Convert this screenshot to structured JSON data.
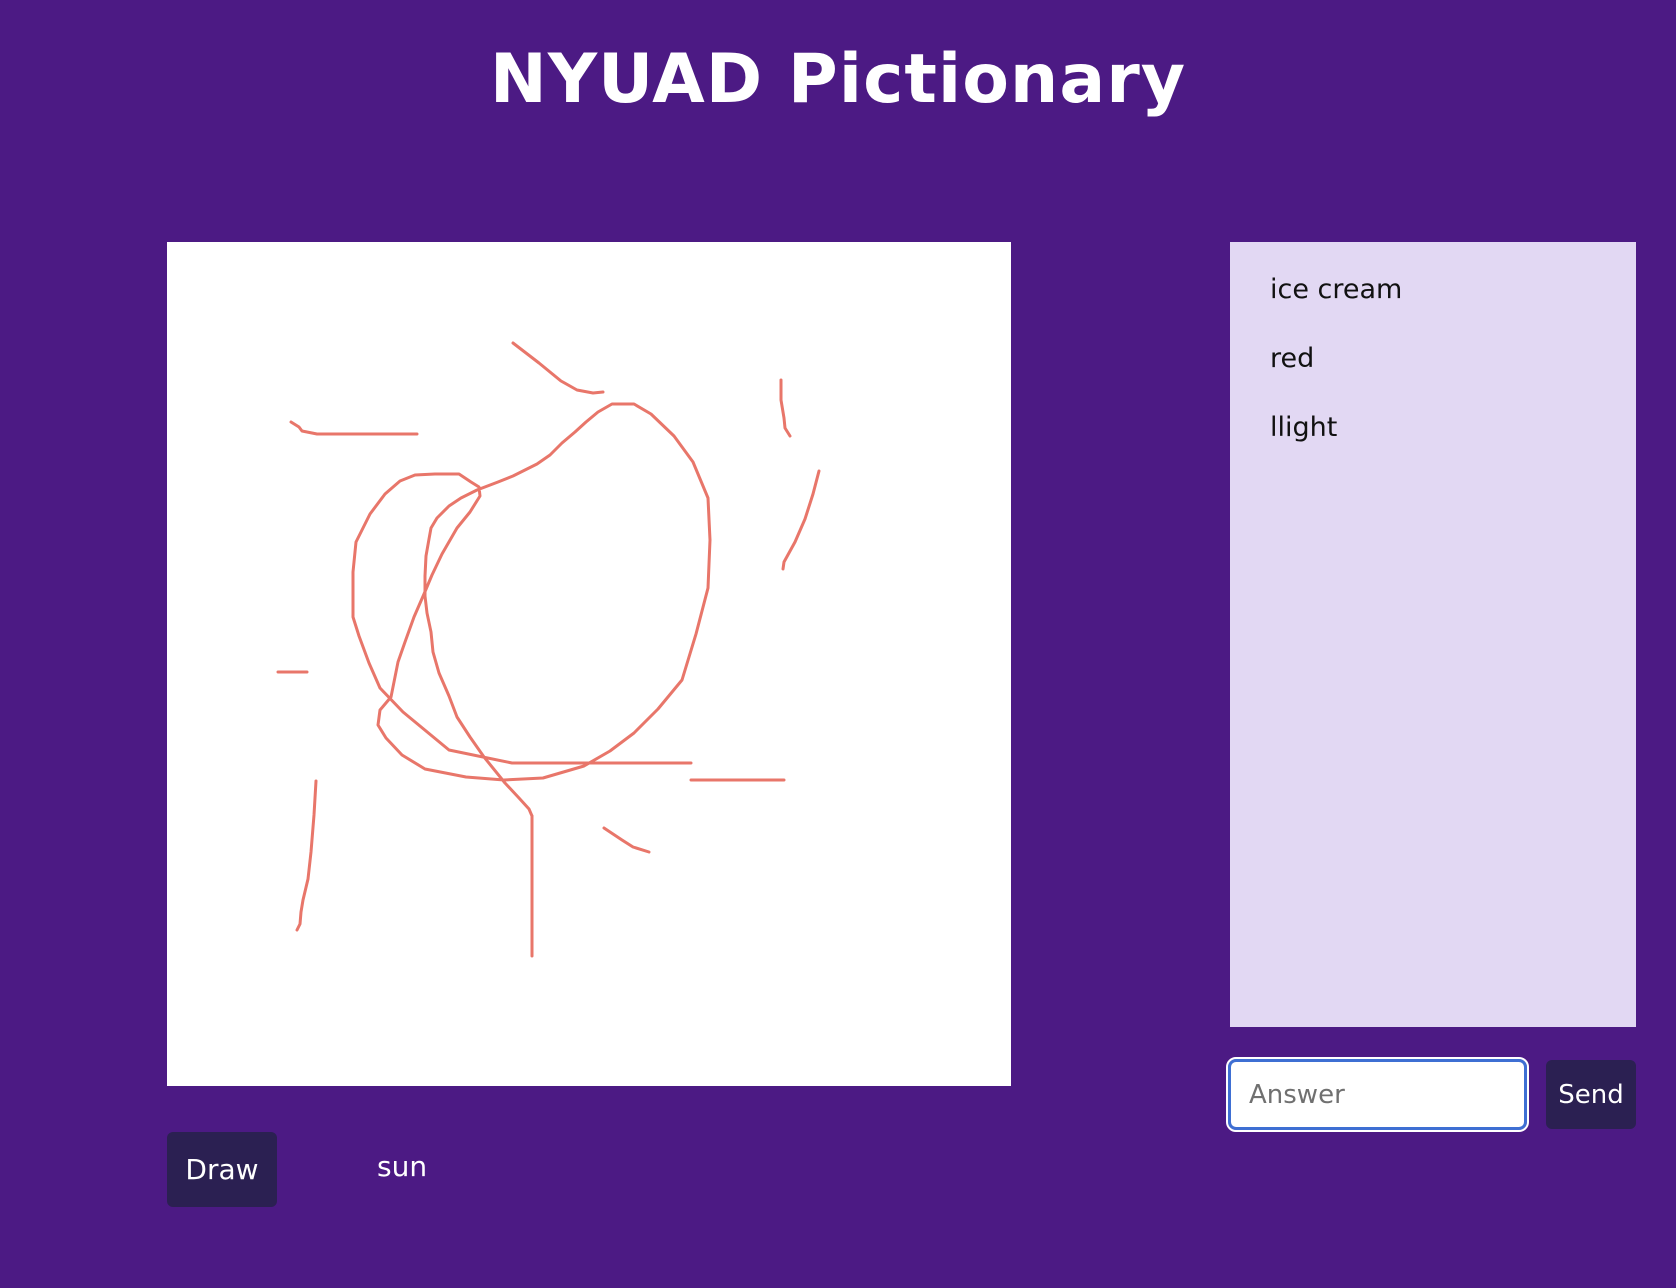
{
  "header": {
    "title": "NYUAD Pictionary"
  },
  "canvas": {
    "stroke_color": "#e8766a"
  },
  "controls": {
    "draw_label": "Draw",
    "secret_word": "sun"
  },
  "chat": {
    "messages": [
      {
        "text": "ice cream"
      },
      {
        "text": "red"
      },
      {
        "text": "llight"
      }
    ]
  },
  "answer": {
    "placeholder": "Answer",
    "value": "",
    "send_label": "Send"
  },
  "colors": {
    "background": "#4c1a84",
    "chat_panel": "#e2d8f3",
    "button": "#2b2052",
    "input_border": "#3e6fd3"
  }
}
